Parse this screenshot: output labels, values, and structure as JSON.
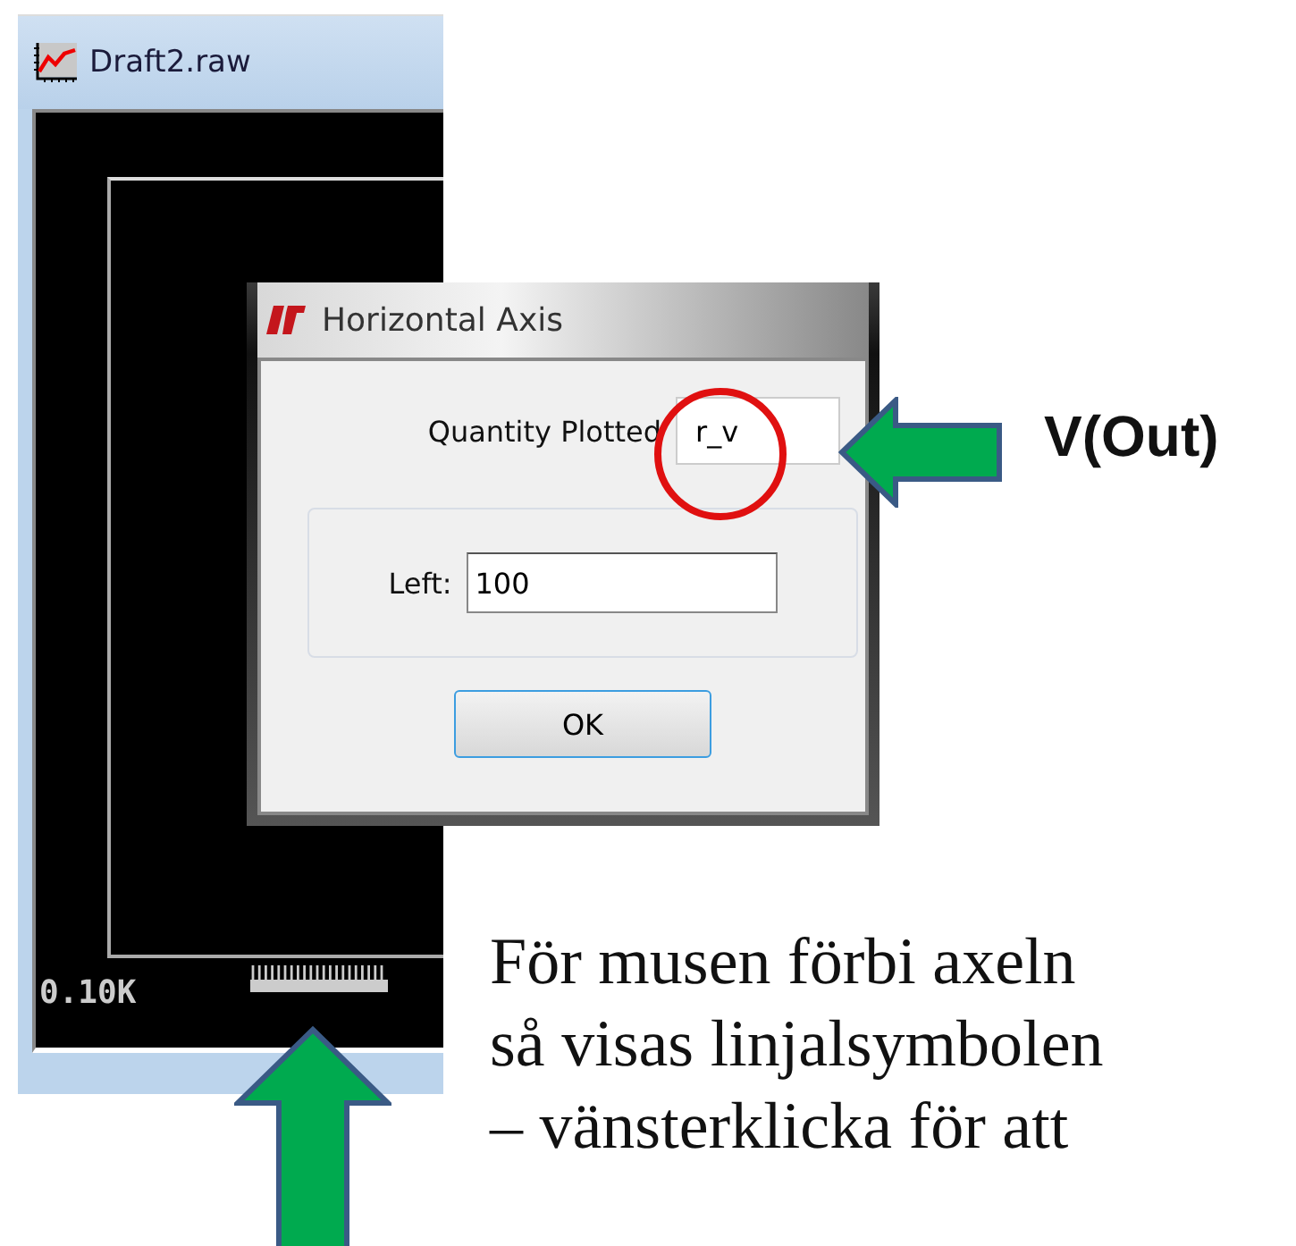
{
  "plot_window": {
    "title": "Draft2.raw",
    "axis_label": "0.10K"
  },
  "dialog": {
    "title": "Horizontal Axis",
    "quantity_label": "Quantity Plotted",
    "quantity_value": "r_v",
    "left_label": "Left:",
    "left_value": "100",
    "ok_button": "OK"
  },
  "callout": "V(Out)",
  "caption": [
    "För musen förbi axeln",
    "så visas linjalsymbolen",
    "– vänsterklicka för att"
  ]
}
